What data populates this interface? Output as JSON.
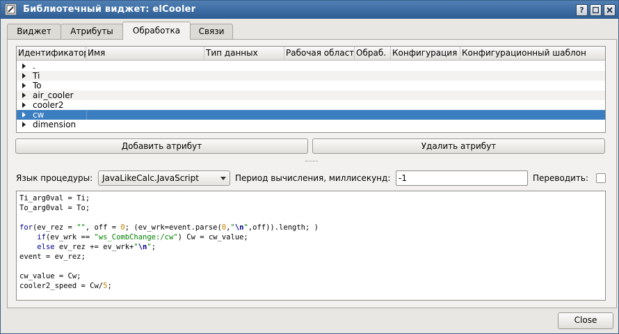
{
  "window": {
    "title": "Библиотечный виджет: elCooler"
  },
  "tabs": [
    {
      "label": "Виджет"
    },
    {
      "label": "Атрибуты"
    },
    {
      "label": "Обработка"
    },
    {
      "label": "Связи"
    }
  ],
  "attributes_table": {
    "columns": [
      "Идентификатор",
      "Имя",
      "Тип данных",
      "Рабочая область",
      "Обраб.",
      "Конфигурация",
      "Конфигурационный шаблон"
    ],
    "rows": [
      {
        "id": "."
      },
      {
        "id": "Ti"
      },
      {
        "id": "To"
      },
      {
        "id": "air_cooler"
      },
      {
        "id": "cooler2"
      },
      {
        "id": "cw"
      },
      {
        "id": "dimension"
      }
    ],
    "selected_row": "cw"
  },
  "buttons": {
    "add_attribute": "Добавить атрибут",
    "delete_attribute": "Удалить атрибут",
    "close": "Close"
  },
  "procedure": {
    "language_label": "Язык процедуры:",
    "language_value": "JavaLikeCalc.JavaScript",
    "period_label": "Период вычисления, миллисекунд:",
    "period_value": "-1",
    "translate_label": "Переводить:",
    "translate_checked": false
  },
  "code_lines": [
    "Ti_arg0val = Ti;",
    "To_arg0val = To;",
    "",
    "for(ev_rez = \"\", off = 0; (ev_wrk=event.parse(0,\"\\n\",off)).length; )",
    "    if(ev_wrk == \"ws_CombChange:/cw\") Cw = cw_value;",
    "    else ev_rez += ev_wrk+\"\\n\";",
    "event = ev_rez;",
    "",
    "cw_value = Cw;",
    "cooler2_speed = Cw/5;"
  ],
  "colors": {
    "titlebar": "#2d5d93",
    "selection": "#3b7fc1",
    "keyword": "#00008b",
    "string": "#008000",
    "number": "#c08000"
  }
}
